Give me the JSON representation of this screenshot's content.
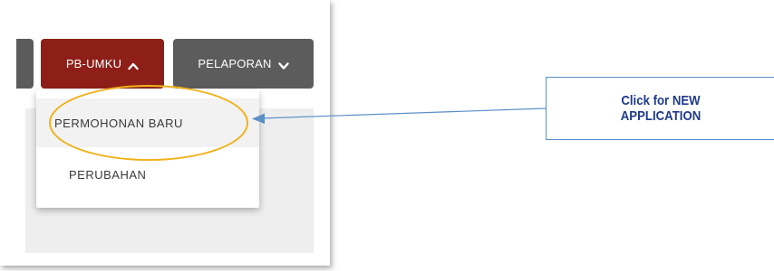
{
  "nav": {
    "items": [
      {
        "label": "PB-UMKU",
        "icon": "chevron-up-icon",
        "color": "#8e1f18",
        "active": true
      },
      {
        "label": "PELAPORAN",
        "icon": "chevron-down-icon",
        "color": "#5c5c5c",
        "active": false
      }
    ]
  },
  "dropdown": {
    "items": [
      {
        "label": "PERMOHONAN BARU"
      },
      {
        "label": "PERUBAHAN"
      }
    ]
  },
  "annotation": {
    "text": "Click for NEW APPLICATION",
    "highlight_color": "#f0b21c",
    "arrow_color": "#5b8fc7",
    "text_color": "#1f3a8a"
  }
}
